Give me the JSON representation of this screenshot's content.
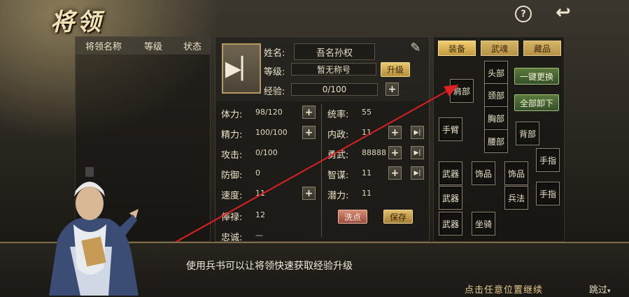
{
  "title": "将领",
  "top_icons": {
    "help": "?",
    "back": "↩"
  },
  "list": {
    "headers": [
      "将领名称",
      "等级",
      "状态"
    ]
  },
  "info": {
    "name_label": "姓名:",
    "name_value": "吾名孙权",
    "level_label": "等级:",
    "level_value": "暂无称号",
    "upgrade_btn": "升级",
    "exp_label": "经验:",
    "exp_value": "0/100",
    "left_stats": [
      {
        "label": "体力:",
        "value": "98/120",
        "plus": true
      },
      {
        "label": "精力:",
        "value": "100/100",
        "plus": true
      },
      {
        "label": "攻击:",
        "value": "0/100",
        "plus": false
      },
      {
        "label": "防御:",
        "value": "0",
        "plus": false
      },
      {
        "label": "速度:",
        "value": "11",
        "plus": true
      },
      {
        "label": "俸禄:",
        "value": "12",
        "plus": false
      },
      {
        "label": "忠诚:",
        "value": "—",
        "plus": false
      }
    ],
    "right_stats": [
      {
        "label": "统率:",
        "value": "55",
        "plus": false
      },
      {
        "label": "内政:",
        "value": "11",
        "plus": true
      },
      {
        "label": "勇武:",
        "value": "88888",
        "plus": true
      },
      {
        "label": "智谋:",
        "value": "11",
        "plus": true
      },
      {
        "label": "潜力:",
        "value": "11",
        "plus": false
      }
    ],
    "wash_btn": "洗点",
    "save_btn": "保存"
  },
  "equip": {
    "tabs": [
      "装备",
      "武魂",
      "藏品"
    ],
    "one_click_replace": "一键更换",
    "unequip_all": "全部卸下",
    "slots": {
      "shoulder": "肩部",
      "head": "头部",
      "neck": "颈部",
      "chest": "胸部",
      "waist": "腰部",
      "arm": "手臂",
      "back": "背部",
      "finger1": "手指",
      "finger2": "手指",
      "weapon1": "武器",
      "weapon2": "武器",
      "weapon3": "武器",
      "ornament1": "饰品",
      "ornament2": "饰品",
      "art_of_war": "兵法",
      "mount": "坐骑"
    }
  },
  "dialog": {
    "text": "使用兵书可以让将领快速获取经验升级",
    "continue": "点击任意位置继续",
    "skip": "跳过"
  },
  "colors": {
    "accent_gold": "#e7c86e",
    "arrow_red": "#e02020",
    "green_btn": "#5a7a3c"
  }
}
